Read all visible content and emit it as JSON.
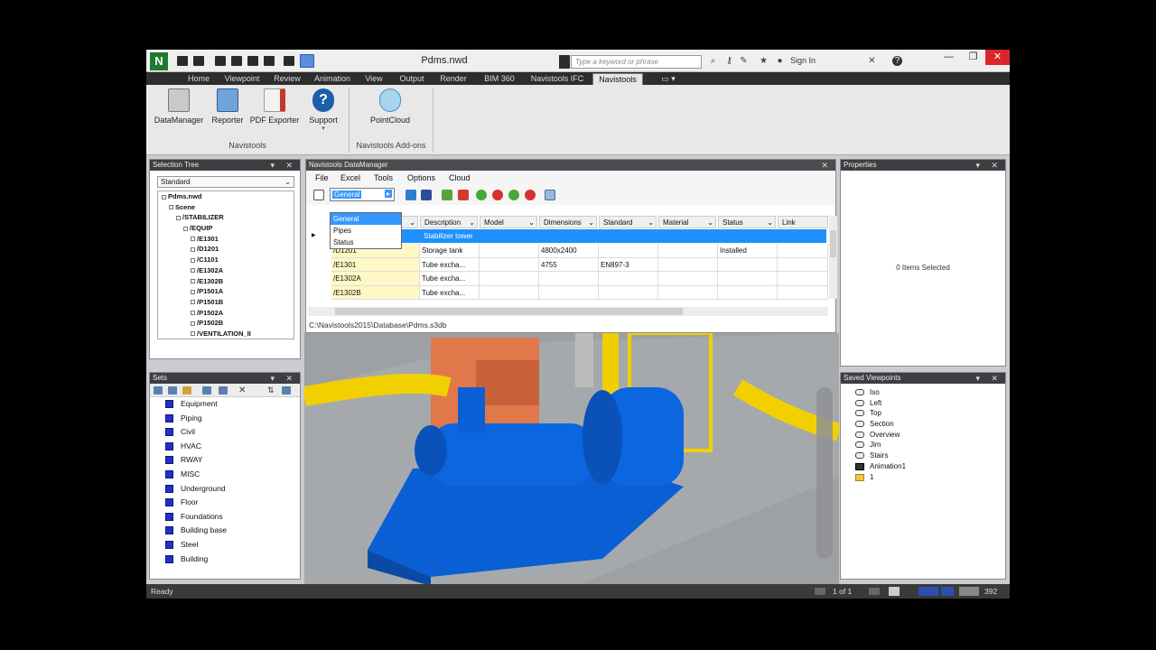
{
  "window": {
    "title": "Pdms.nwd",
    "search_placeholder": "Type a keyword or phrase",
    "sign_in": "Sign In"
  },
  "tabs": [
    "Home",
    "Viewpoint",
    "Review",
    "Animation",
    "View",
    "Output",
    "Render",
    "BIM 360",
    "Navistools IFC",
    "Navistools"
  ],
  "active_tab": "Navistools",
  "ribbon": {
    "navistools": {
      "buttons": [
        "DataManager",
        "Reporter",
        "PDF Exporter",
        "Support"
      ],
      "group_label": "Navistools"
    },
    "addons": {
      "buttons": [
        "PointCloud"
      ],
      "group_label": "Navistools Add-ons"
    }
  },
  "selection_tree": {
    "title": "Selection Tree",
    "mode": "Standard",
    "items": [
      {
        "label": "Pdms.nwd",
        "level": 0
      },
      {
        "label": "Scene",
        "level": 1
      },
      {
        "label": "/STABILIZER",
        "level": 2
      },
      {
        "label": "/EQUIP",
        "level": 3
      },
      {
        "label": "/E1301",
        "level": 4
      },
      {
        "label": "/D1201",
        "level": 4
      },
      {
        "label": "/C1101",
        "level": 4
      },
      {
        "label": "/E1302A",
        "level": 4
      },
      {
        "label": "/E1302B",
        "level": 4
      },
      {
        "label": "/P1501A",
        "level": 4
      },
      {
        "label": "/P1501B",
        "level": 4
      },
      {
        "label": "/P1502A",
        "level": 4
      },
      {
        "label": "/P1502B",
        "level": 4
      },
      {
        "label": "/VENTILATION_II",
        "level": 4
      }
    ]
  },
  "sets": {
    "title": "Sets",
    "items": [
      "Equipment",
      "Piping",
      "Civil",
      "HVAC",
      "RWAY",
      "MISC",
      "Underground",
      "Floor",
      "Foundations",
      "Building base",
      "Steel",
      "Building"
    ]
  },
  "datamanager": {
    "title": "Navistools DataManager",
    "menu": [
      "File",
      "Excel",
      "Tools",
      "Options",
      "Cloud"
    ],
    "combo_value": "General",
    "combo_options": [
      "General",
      "Pipes",
      "Status"
    ],
    "columns": [
      "Description",
      "Model",
      "Dimensions",
      "Standard",
      "Material",
      "Status",
      "Link"
    ],
    "group_row": "Stabilizer tower",
    "rows": [
      {
        "name": "/D1201",
        "description": "Storage tank",
        "model": "",
        "dimensions": "4800x2400",
        "standard": "",
        "material": "",
        "status": "Installed",
        "link": ""
      },
      {
        "name": "/E1301",
        "description": "Tube excha...",
        "model": "",
        "dimensions": "4755",
        "standard": "EN897-3",
        "material": "",
        "status": "",
        "link": ""
      },
      {
        "name": "/E1302A",
        "description": "Tube excha...",
        "model": "",
        "dimensions": "",
        "standard": "",
        "material": "",
        "status": "",
        "link": ""
      },
      {
        "name": "/E1302B",
        "description": "Tube excha...",
        "model": "",
        "dimensions": "",
        "standard": "",
        "material": "",
        "status": "",
        "link": ""
      }
    ],
    "path": "C:\\Navistools2015\\Database\\Pdms.s3db"
  },
  "properties": {
    "title": "Properties",
    "message": "0 Items Selected"
  },
  "saved_viewpoints": {
    "title": "Saved Viewpoints",
    "items": [
      {
        "label": "Iso",
        "type": "camera"
      },
      {
        "label": "Left",
        "type": "camera"
      },
      {
        "label": "Top",
        "type": "camera"
      },
      {
        "label": "Section",
        "type": "camera"
      },
      {
        "label": "Overview",
        "type": "camera"
      },
      {
        "label": "Jim",
        "type": "camera"
      },
      {
        "label": "Stairs",
        "type": "camera"
      },
      {
        "label": "Animation1",
        "type": "animation"
      },
      {
        "label": "1",
        "type": "folder"
      }
    ]
  },
  "status_bar": {
    "left": "Ready",
    "page": "1 of 1",
    "zoom": "392"
  },
  "colors": {
    "pump_blue": "#0a5fd4",
    "pipe_yellow": "#f2d000",
    "motor_orange": "#e07a45",
    "selection_blue": "#1e90ff",
    "ribbon_dark": "#2d2d2d"
  }
}
